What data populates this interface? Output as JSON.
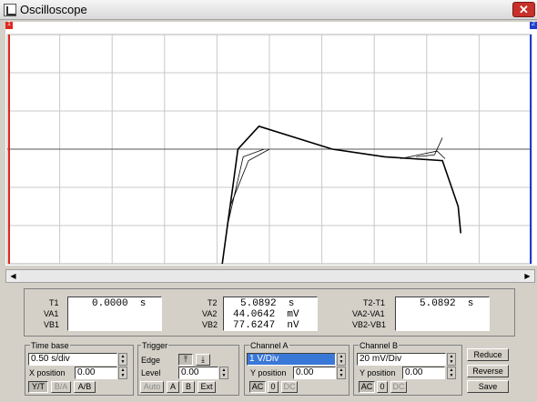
{
  "window": {
    "title": "Oscilloscope",
    "close_glyph": "✕"
  },
  "markers": {
    "t1": "1",
    "t2": "2"
  },
  "chart_data": {
    "type": "line",
    "title": "",
    "grid": true,
    "x_divisions": 10,
    "y_divisions": 6,
    "trace_color": "#000000",
    "t1_color": "#e0281e",
    "t2_color": "#1e3ed0",
    "series": [
      {
        "values": [
          [
            4.1,
            3.0
          ],
          [
            4.2,
            2.0
          ],
          [
            4.3,
            1.0
          ],
          [
            4.4,
            0.0
          ],
          [
            4.8,
            -0.6
          ],
          [
            6.2,
            0.0
          ],
          [
            7.2,
            0.2
          ],
          [
            8.3,
            0.3
          ],
          [
            8.6,
            1.5
          ],
          [
            8.65,
            2.2
          ]
        ]
      }
    ]
  },
  "scroll": {
    "left": "◀",
    "right": "▶"
  },
  "readout": {
    "t1": {
      "label": "T1",
      "time": "0.0000  s",
      "va_label": "VA1",
      "vb_label": "VB1",
      "va": "",
      "vb": ""
    },
    "t2": {
      "label": "T2",
      "time": "5.0892  s",
      "va_label": "VA2",
      "vb_label": "VB2",
      "va": "44.0642  mV",
      "vb": "77.6247  nV"
    },
    "diff": {
      "label": "T2-T1",
      "time": "5.0892  s",
      "va_label": "VA2-VA1",
      "vb_label": "VB2-VB1",
      "va": "",
      "vb": ""
    }
  },
  "timebase": {
    "title": "Time base",
    "scale": "0.50 s/div",
    "xpos_label": "X position",
    "xpos": "0.00",
    "btn_yt": "Y/T",
    "btn_ba": "B/A",
    "btn_ab": "A/B"
  },
  "trigger": {
    "title": "Trigger",
    "edge_label": "Edge",
    "edge_rise": "⤒",
    "edge_fall": "⤓",
    "level_label": "Level",
    "level": "0.00",
    "btn_auto": "Auto",
    "btn_a": "A",
    "btn_b": "B",
    "btn_ext": "Ext"
  },
  "channel_a": {
    "title": "Channel A",
    "scale": "1 V/Div",
    "ypos_label": "Y position",
    "ypos": "0.00",
    "btn_ac": "AC",
    "btn_0": "0",
    "btn_dc": "DC"
  },
  "channel_b": {
    "title": "Channel B",
    "scale": "20 mV/Div",
    "ypos_label": "Y position",
    "ypos": "0.00",
    "btn_ac": "AC",
    "btn_0": "0",
    "btn_dc": "DC"
  },
  "side": {
    "reduce": "Reduce",
    "reverse": "Reverse",
    "save": "Save"
  }
}
